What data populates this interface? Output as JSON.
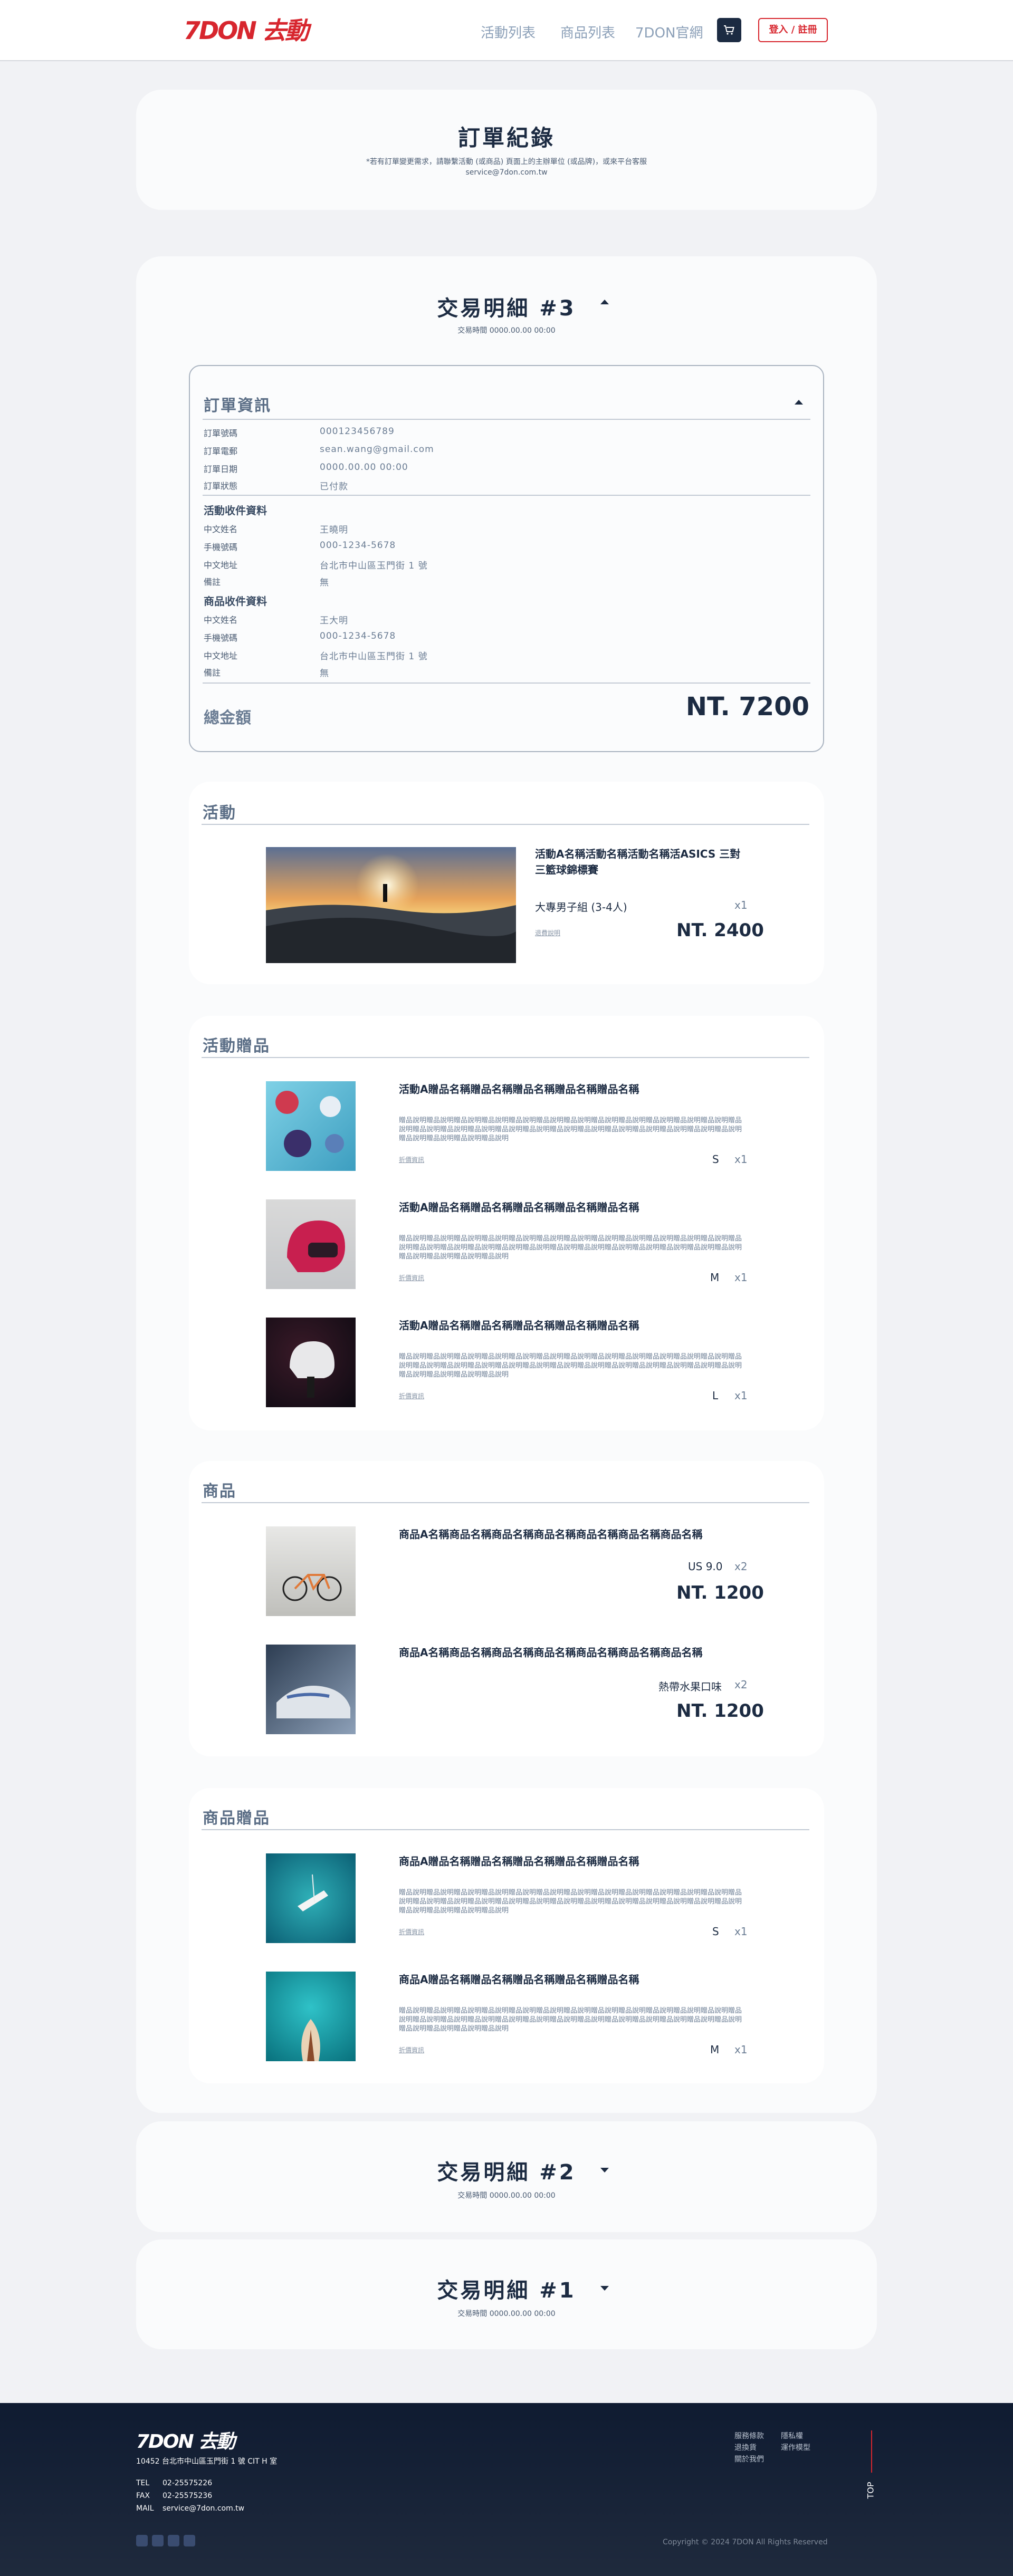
{
  "header": {
    "logo": "7DON 去動",
    "nav": [
      "活動列表",
      "商品列表",
      "7DON官網"
    ],
    "login": "登入 / 註冊"
  },
  "intro": {
    "title": "訂單紀錄",
    "notice": "*若有訂單變更需求，請聯繫活動 (或商品) 頁面上的主辦單位 (或品牌)，或來平台客服",
    "email": "service@7don.com.tw"
  },
  "tx3": {
    "title": "交易明細 #3",
    "time": "交易時間 0000.00.00 00:00"
  },
  "order": {
    "title": "訂單資訊",
    "rows": [
      [
        "訂單號碼",
        "000123456789"
      ],
      [
        "訂單電郵",
        "sean.wang@gmail.com"
      ],
      [
        "訂單日期",
        "0000.00.00 00:00"
      ],
      [
        "訂單狀態",
        "已付款"
      ]
    ],
    "activity_heading": "活動收件資料",
    "activity_rows": [
      [
        "中文姓名",
        "王曉明"
      ],
      [
        "手機號碼",
        "000-1234-5678"
      ],
      [
        "中文地址",
        "台北市中山區玉門街 1 號"
      ],
      [
        "備註",
        "無"
      ]
    ],
    "product_heading": "商品收件資料",
    "product_rows": [
      [
        "中文姓名",
        "王大明"
      ],
      [
        "手機號碼",
        "000-1234-5678"
      ],
      [
        "中文地址",
        "台北市中山區玉門街 1 號"
      ],
      [
        "備註",
        "無"
      ]
    ],
    "total_label": "總金額",
    "total": "NT. 7200"
  },
  "activity": {
    "heading": "活動",
    "title": "活動A名稱活動名稱活動名稱活ASICS 三對三籃球錦標賽",
    "option": "大專男子組 (3-4人)",
    "qty": "x1",
    "link": "退費說明",
    "price": "NT. 2400"
  },
  "gifts": {
    "heading": "活動贈品",
    "desc": "贈品說明贈品說明贈品說明贈品說明贈品說明贈品說明贈品說明贈品說明贈品說明贈品說明贈品說明贈品說明贈品說明贈品說明贈品說明贈品說明贈品說明贈品說明贈品說明贈品說明贈品說明贈品說明贈品說明贈品說明贈品說明贈品說明贈品說明贈品說明贈品說明",
    "items": [
      {
        "title": "活動A贈品名稱贈品名稱贈品名稱贈品名稱贈品名稱",
        "link": "折價資訊",
        "size": "S",
        "qty": "x1"
      },
      {
        "title": "活動A贈品名稱贈品名稱贈品名稱贈品名稱贈品名稱",
        "link": "折價資訊",
        "size": "M",
        "qty": "x1"
      },
      {
        "title": "活動A贈品名稱贈品名稱贈品名稱贈品名稱贈品名稱",
        "link": "折價資訊",
        "size": "L",
        "qty": "x1"
      }
    ]
  },
  "products": {
    "heading": "商品",
    "items": [
      {
        "title": "商品A名稱商品名稱商品名稱商品名稱商品名稱商品名稱商品名稱",
        "option": "US 9.0",
        "qty": "x2",
        "price": "NT. 1200"
      },
      {
        "title": "商品A名稱商品名稱商品名稱商品名稱商品名稱商品名稱商品名稱",
        "option": "熱帶水果口味",
        "qty": "x2",
        "price": "NT. 1200"
      }
    ]
  },
  "pgifts": {
    "heading": "商品贈品",
    "desc": "贈品說明贈品說明贈品說明贈品說明贈品說明贈品說明贈品說明贈品說明贈品說明贈品說明贈品說明贈品說明贈品說明贈品說明贈品說明贈品說明贈品說明贈品說明贈品說明贈品說明贈品說明贈品說明贈品說明贈品說明贈品說明贈品說明贈品說明贈品說明贈品說明",
    "items": [
      {
        "title": "商品A贈品名稱贈品名稱贈品名稱贈品名稱贈品名稱",
        "link": "折價資訊",
        "size": "S",
        "qty": "x1"
      },
      {
        "title": "商品A贈品名稱贈品名稱贈品名稱贈品名稱贈品名稱",
        "link": "折價資訊",
        "size": "M",
        "qty": "x1"
      }
    ]
  },
  "tx2": {
    "title": "交易明細 #2",
    "time": "交易時間 0000.00.00 00:00"
  },
  "tx1": {
    "title": "交易明細 #1",
    "time": "交易時間 0000.00.00 00:00"
  },
  "footer": {
    "logo": "7DON 去動",
    "address": "10452 台北市中山區玉門街 1 號 CIT H 室",
    "tel_label": "TEL",
    "tel": "02-25575226",
    "fax_label": "FAX",
    "fax": "02-25575236",
    "mail_label": "MAIL",
    "mail": "service@7don.com.tw",
    "links": [
      "服務條款",
      "隱私權",
      "退換貨",
      "運作模型",
      "關於我們"
    ],
    "top": "TOP",
    "copyright": "Copyright © 2024 7DON All Rights Reserved"
  },
  "colors": {
    "brand": "#d7262e",
    "navy": "#1c2b42"
  }
}
